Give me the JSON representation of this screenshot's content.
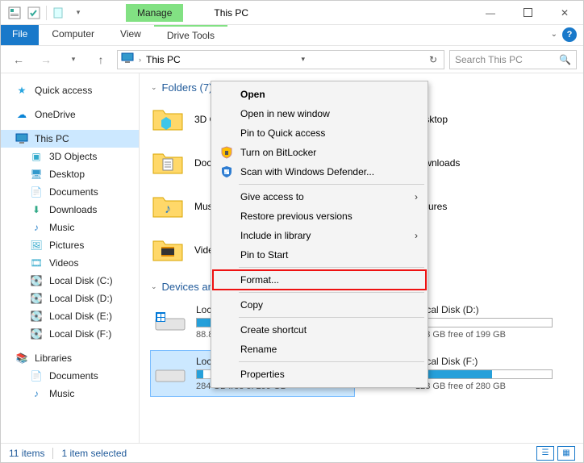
{
  "window": {
    "title": "This PC",
    "manage_label": "Manage"
  },
  "ribbon": {
    "file": "File",
    "computer": "Computer",
    "view": "View",
    "drive_tools": "Drive Tools"
  },
  "address": {
    "location": "This PC",
    "search_placeholder": "Search This PC"
  },
  "sidebar": {
    "quick_access": "Quick access",
    "onedrive": "OneDrive",
    "this_pc": "This PC",
    "children": [
      "3D Objects",
      "Desktop",
      "Documents",
      "Downloads",
      "Music",
      "Pictures",
      "Videos",
      "Local Disk (C:)",
      "Local Disk (D:)",
      "Local Disk (E:)",
      "Local Disk (F:)"
    ],
    "libraries": "Libraries",
    "lib_children": [
      "Documents",
      "Music"
    ]
  },
  "sections": {
    "folders": "Folders (7)",
    "devices": "Devices and drives (4)"
  },
  "folders": [
    {
      "label": "3D Objects"
    },
    {
      "label": "Desktop"
    },
    {
      "label": "Documents"
    },
    {
      "label": "Downloads"
    },
    {
      "label": "Music"
    },
    {
      "label": "Pictures"
    },
    {
      "label": "Videos"
    }
  ],
  "drives": [
    {
      "label": "Local Disk (C:)",
      "free": "88.8 GB free of 118 GB",
      "fill_pct": 26
    },
    {
      "label": "Local Disk (D:)",
      "free": "183 GB free of 199 GB",
      "fill_pct": 8
    },
    {
      "label": "Local Disk (E:)",
      "free": "284 GB free of 299 GB",
      "fill_pct": 5,
      "selected": true
    },
    {
      "label": "Local Disk (F:)",
      "free": "123 GB free of 280 GB",
      "fill_pct": 56
    }
  ],
  "context_menu": {
    "open": "Open",
    "open_new": "Open in new window",
    "pin_qa": "Pin to Quick access",
    "bitlocker": "Turn on BitLocker",
    "defender": "Scan with Windows Defender...",
    "give_access": "Give access to",
    "restore": "Restore previous versions",
    "include_lib": "Include in library",
    "pin_start": "Pin to Start",
    "format": "Format...",
    "copy": "Copy",
    "create_shortcut": "Create shortcut",
    "rename": "Rename",
    "properties": "Properties"
  },
  "status": {
    "count": "11 items",
    "selected": "1 item selected"
  }
}
